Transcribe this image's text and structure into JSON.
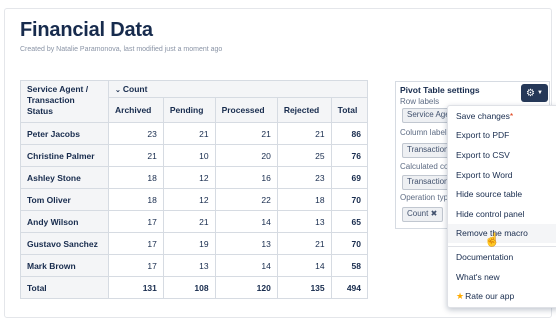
{
  "page": {
    "title": "Financial Data",
    "byline": "Created by Natalie Paramonova, last modified just a moment ago"
  },
  "table": {
    "agent_header": "Service Agent / Transaction Status",
    "group_header": "Count",
    "columns": [
      "Archived",
      "Pending",
      "Processed",
      "Rejected",
      "Total"
    ],
    "rows": [
      {
        "agent": "Peter Jacobs",
        "values": [
          "23",
          "21",
          "21",
          "21",
          "86"
        ]
      },
      {
        "agent": "Christine Palmer",
        "values": [
          "21",
          "10",
          "20",
          "25",
          "76"
        ]
      },
      {
        "agent": "Ashley Stone",
        "values": [
          "18",
          "12",
          "16",
          "23",
          "69"
        ]
      },
      {
        "agent": "Tom Oliver",
        "values": [
          "18",
          "12",
          "22",
          "18",
          "70"
        ]
      },
      {
        "agent": "Andy Wilson",
        "values": [
          "17",
          "21",
          "14",
          "13",
          "65"
        ]
      },
      {
        "agent": "Gustavo Sanchez",
        "values": [
          "17",
          "19",
          "13",
          "21",
          "70"
        ]
      },
      {
        "agent": "Mark Brown",
        "values": [
          "17",
          "13",
          "14",
          "14",
          "58"
        ]
      }
    ],
    "total_row": {
      "agent": "Total",
      "values": [
        "131",
        "108",
        "120",
        "135",
        "494"
      ]
    }
  },
  "settings": {
    "title": "Pivot Table settings",
    "row_labels_label": "Row labels",
    "row_labels_chip": "Service Agent",
    "column_labels_label": "Column labels",
    "column_labels_chip": "Transaction Status",
    "calculated_label": "Calculated column",
    "calculated_chip": "Transaction ID",
    "operation_label": "Operation type",
    "operation_chip": "Count"
  },
  "menu": {
    "items": [
      "Save changes",
      "Export to PDF",
      "Export to CSV",
      "Export to Word",
      "Hide source table",
      "Hide control panel",
      "Remove the macro",
      "Documentation",
      "What's new",
      "Rate our app"
    ],
    "save_asterisk": "*"
  },
  "icons": {
    "gear": "gear-icon",
    "remove": "close-icon",
    "star": "star-icon",
    "cursor": "hand-pointer-icon"
  },
  "colors": {
    "gear_button_bg": "#253858",
    "star": "#ffab00",
    "asterisk": "#de350b"
  }
}
